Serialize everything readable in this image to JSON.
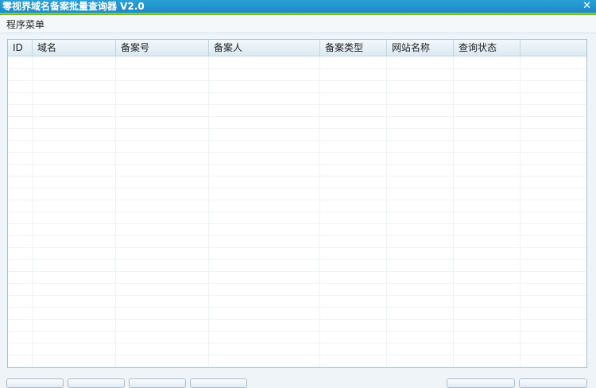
{
  "window": {
    "title": "零视界域名备案批量查询器 V2.0",
    "close_icon": "close-icon"
  },
  "menu": {
    "label": "程序菜单"
  },
  "table": {
    "columns": [
      "ID",
      "域名",
      "备案号",
      "备案人",
      "备案类型",
      "网站名称",
      "查询状态"
    ]
  }
}
